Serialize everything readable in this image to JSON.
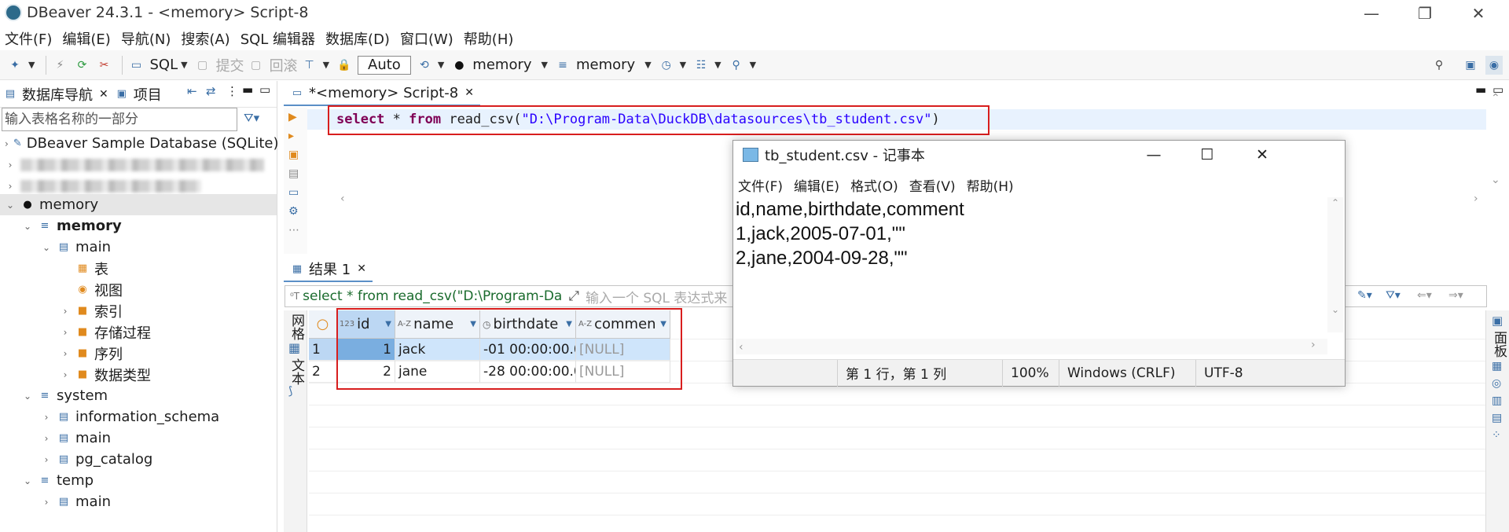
{
  "window": {
    "title": "DBeaver 24.3.1 - <memory> Script-8"
  },
  "menu": [
    "文件(F)",
    "编辑(E)",
    "导航(N)",
    "搜索(A)",
    "SQL 编辑器",
    "数据库(D)",
    "窗口(W)",
    "帮助(H)"
  ],
  "toolbar": {
    "sql": "SQL",
    "commit": "提交",
    "rollback": "回滚",
    "auto": "Auto",
    "datasource": "memory",
    "schema": "memory"
  },
  "navigator": {
    "tab_db": "数据库导航",
    "tab_project": "项目",
    "filter_placeholder": "输入表格名称的一部分",
    "items": {
      "sample_db": "DBeaver Sample Database (SQLite)",
      "memory": "memory",
      "memory_db": "memory",
      "main": "main",
      "tables": "表",
      "views": "视图",
      "indexes": "索引",
      "procedures": "存储过程",
      "sequences": "序列",
      "datatypes": "数据类型",
      "system": "system",
      "info_schema": "information_schema",
      "sys_main": "main",
      "pg_catalog": "pg_catalog",
      "temp": "temp",
      "temp_main": "main"
    }
  },
  "editor": {
    "tab": "*<memory> Script-8",
    "sql": {
      "kw1": "select",
      "mid1": " * ",
      "kw2": "from",
      "fn": " read_csv(",
      "path": "\"D:\\Program-Data\\DuckDB\\datasources\\tb_student.csv\"",
      "close": ")"
    }
  },
  "results": {
    "tab": "结果 1",
    "filter_text": "select * from read_csv(\"D:\\Program-Da",
    "filter_placeholder": "输入一个 SQL 表达式来",
    "side_grid": "网格",
    "side_text": "文本",
    "right_panel": "面板",
    "columns": [
      {
        "name": "id",
        "type": "123"
      },
      {
        "name": "name",
        "type": "A-Z"
      },
      {
        "name": "birthdate",
        "type": "◷"
      },
      {
        "name": "commen",
        "type": "A-Z"
      }
    ],
    "rows": [
      {
        "num": "1",
        "id": "1",
        "name": "jack",
        "birthdate": "-01 00:00:00.0",
        "comment": "[NULL]"
      },
      {
        "num": "2",
        "id": "2",
        "name": "jane",
        "birthdate": "-28 00:00:00.0",
        "comment": "[NULL]"
      }
    ]
  },
  "notepad": {
    "title": "tb_student.csv - 记事本",
    "menu": [
      "文件(F)",
      "编辑(E)",
      "格式(O)",
      "查看(V)",
      "帮助(H)"
    ],
    "lines": [
      "id,name,birthdate,comment",
      "1,jack,2005-07-01,\"\"",
      "2,jane,2004-09-28,\"\""
    ],
    "status": {
      "position": "第 1 行，第 1 列",
      "zoom": "100%",
      "eol": "Windows (CRLF)",
      "encoding": "UTF-8"
    }
  },
  "colors": {
    "highlight": "#d81e1e",
    "selection": "#cfe5fb",
    "accent": "#5b8fc7"
  }
}
